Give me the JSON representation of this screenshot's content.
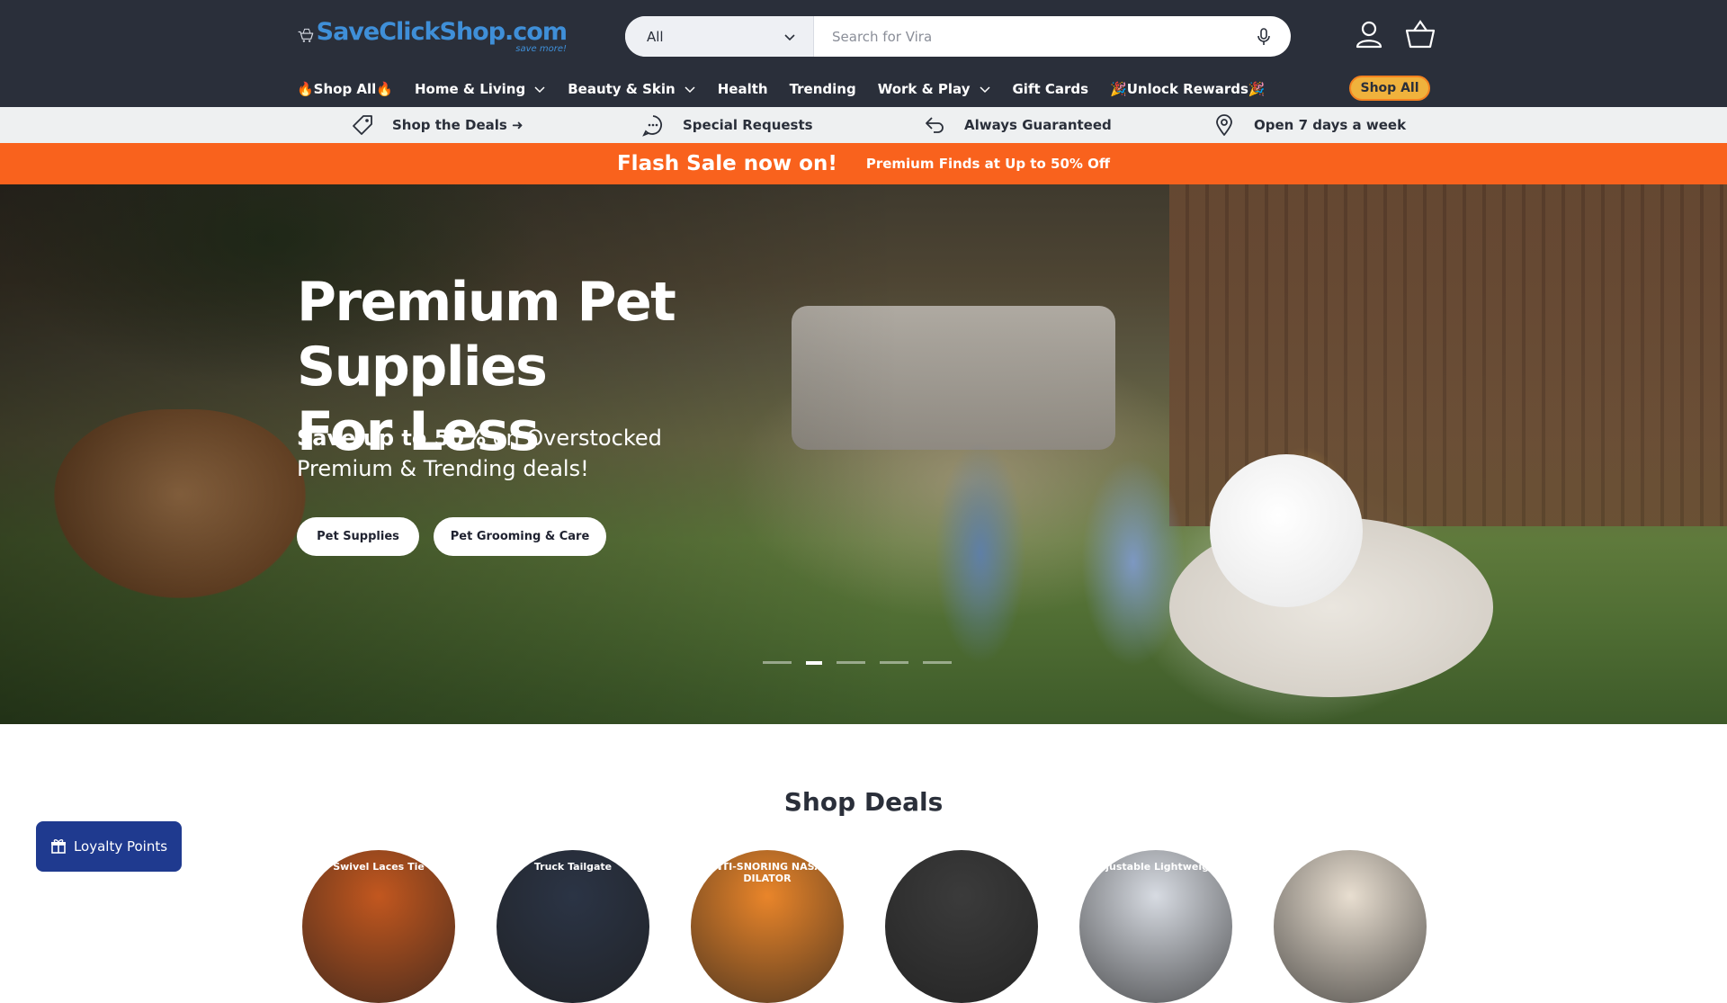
{
  "header": {
    "logo": {
      "main": "SaveClickShop.com",
      "sub": "save more!"
    },
    "search": {
      "category": "All",
      "placeholder": "Search for Vira"
    },
    "account_icon": "user-icon",
    "cart_icon": "basket-icon",
    "mic_icon": "microphone-icon"
  },
  "nav": {
    "items": [
      {
        "label": "🔥Shop All🔥",
        "dropdown": false
      },
      {
        "label": "Home & Living",
        "dropdown": true
      },
      {
        "label": "Beauty & Skin",
        "dropdown": true
      },
      {
        "label": "Health",
        "dropdown": false
      },
      {
        "label": "Trending",
        "dropdown": false
      },
      {
        "label": "Work & Play",
        "dropdown": true
      },
      {
        "label": "Gift Cards",
        "dropdown": false
      },
      {
        "label": "🎉Unlock Rewards🎉",
        "dropdown": false
      }
    ],
    "shop_all_button": "Shop All"
  },
  "trust_bar": [
    {
      "label": "Shop the Deals ➜",
      "icon": "tag-icon"
    },
    {
      "label": "Special Requests",
      "icon": "chat-icon"
    },
    {
      "label": "Always Guaranteed",
      "icon": "return-arrow-icon"
    },
    {
      "label": "Open 7 days a week",
      "icon": "location-pin-icon"
    }
  ],
  "flash": {
    "main": "Flash Sale now on!",
    "sub": "Premium Finds at Up to 50% Off"
  },
  "hero": {
    "title_line1": "Premium Pet Supplies",
    "title_line2": "For Less",
    "subtitle_bold": "Save up to 50%",
    "subtitle_rest1": " on Overstocked",
    "subtitle_line2": "Premium & Trending deals!",
    "buttons": [
      "Pet Supplies",
      "Pet Grooming & Care"
    ],
    "slides_total": 5,
    "active_slide": 2
  },
  "deals": {
    "title": "Shop Deals",
    "tiles": [
      {
        "caption": "Swivel Laces Tie",
        "color": "#c2571f"
      },
      {
        "caption": "Truck Tailgate",
        "color": "#2b3445"
      },
      {
        "caption": "ANTI-SNORING NASAL DILATOR",
        "color": "#e9852a"
      },
      {
        "caption": "",
        "color": "#3b3b3b"
      },
      {
        "caption": "Adjustable Lightweight",
        "color": "#d7dbe2"
      },
      {
        "caption": "",
        "color": "#e8ded0"
      }
    ]
  },
  "loyalty": {
    "label": "Loyalty Points",
    "icon": "gift-icon"
  },
  "colors": {
    "header_bg": "#2a2f3a",
    "flash_bg": "#f9621d",
    "accent_orange": "#f58220",
    "loyalty_bg": "#1f3a8f",
    "logo_blue": "#3f8fd8"
  }
}
